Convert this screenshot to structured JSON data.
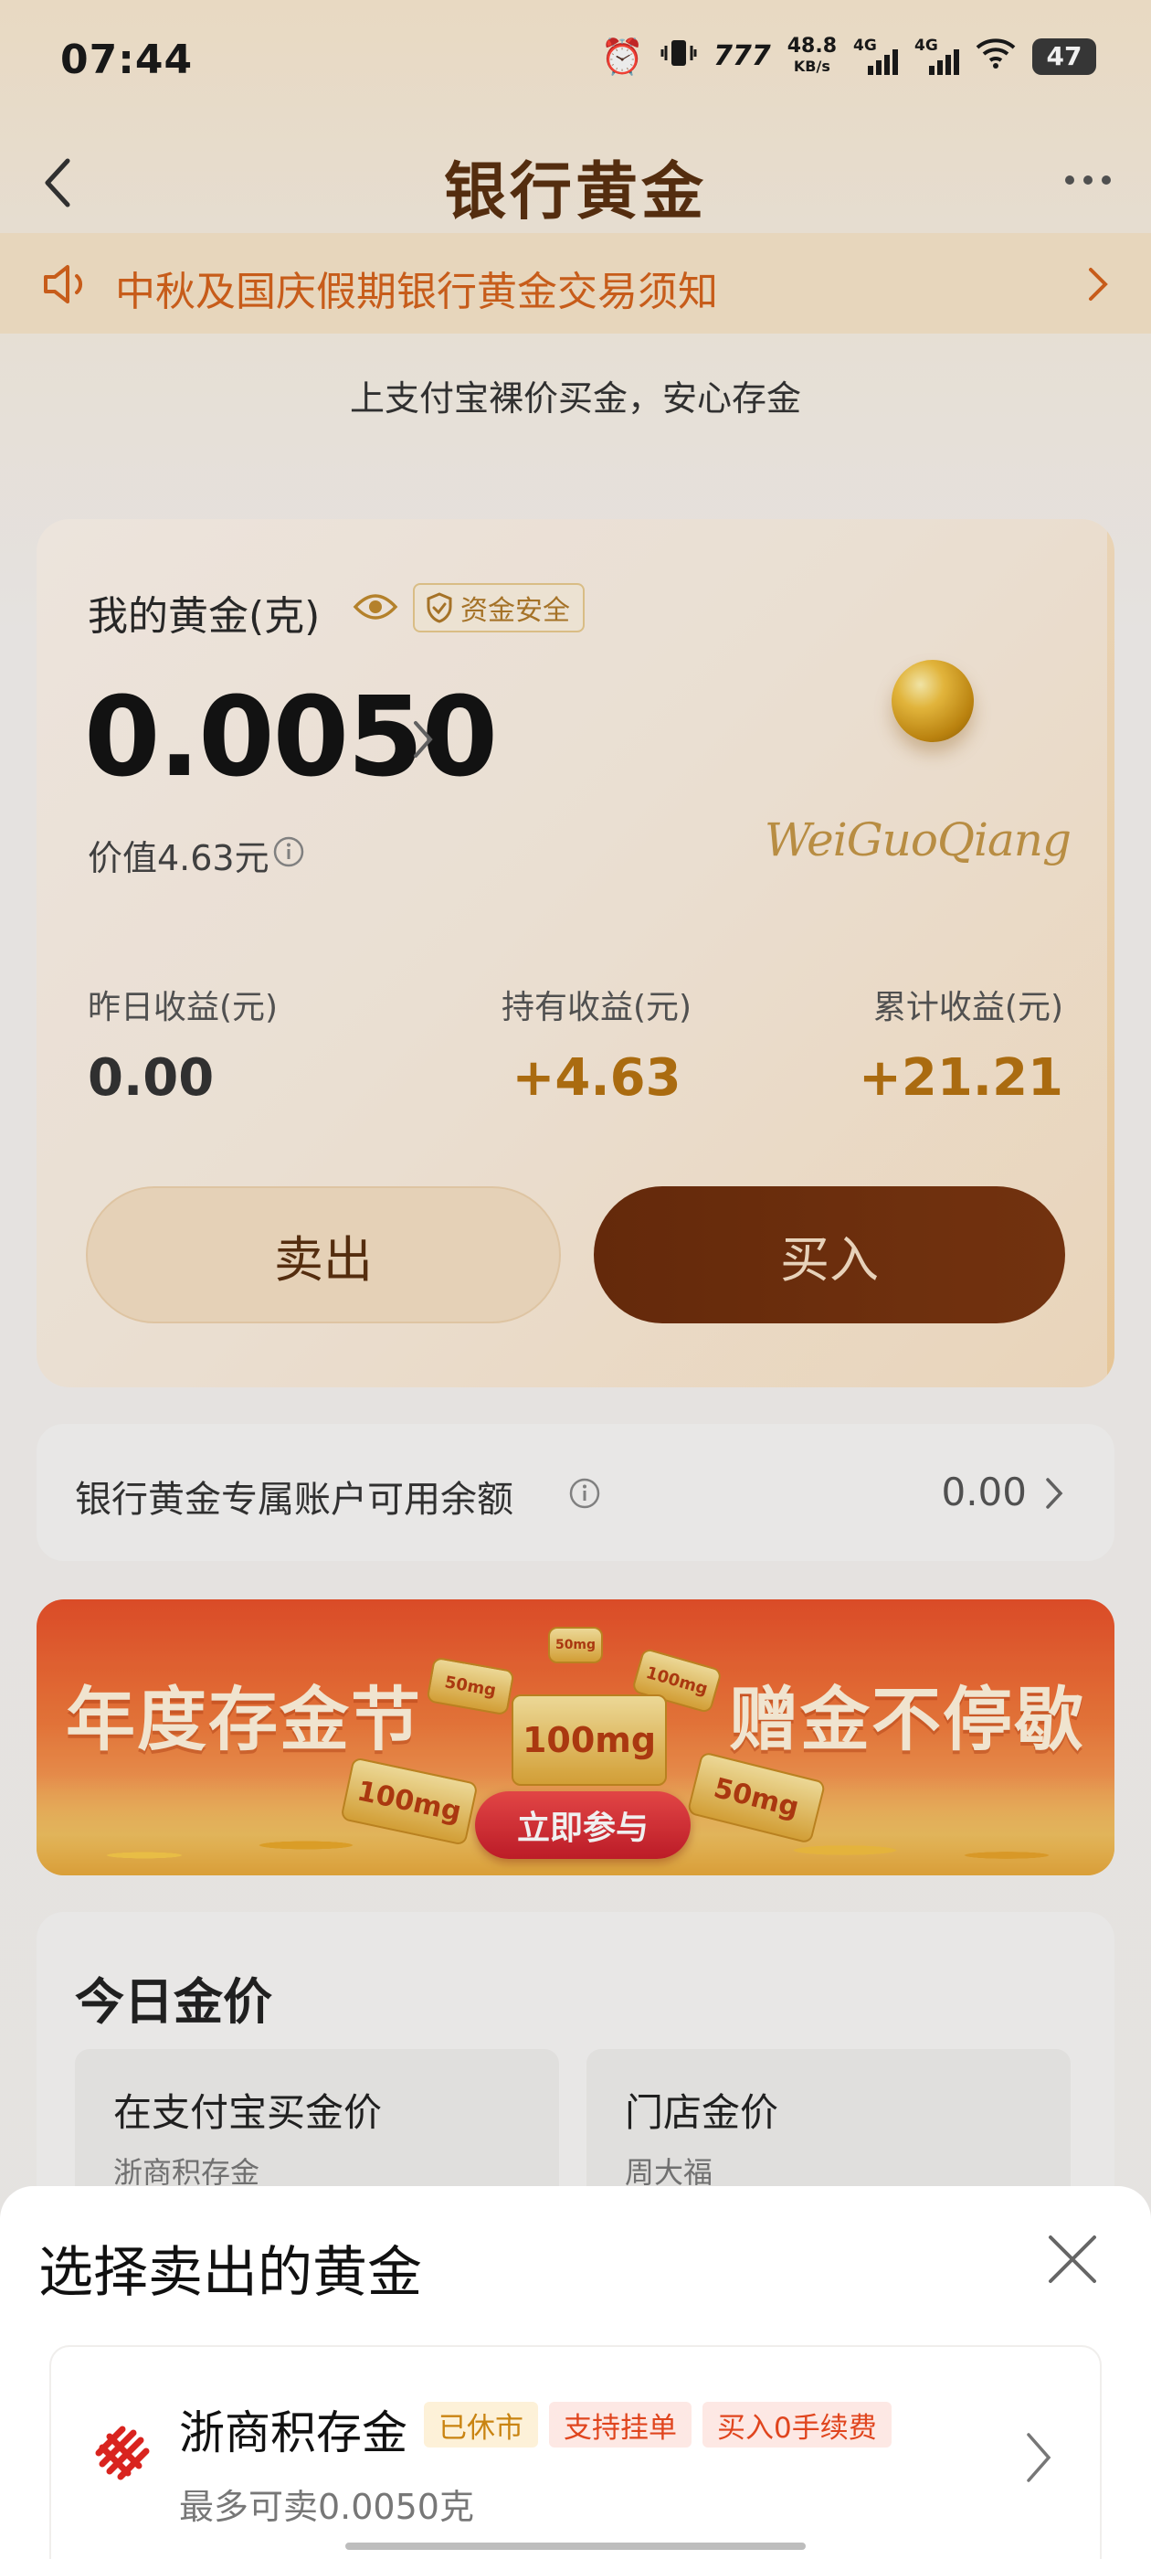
{
  "status_bar": {
    "time": "07:44",
    "net_speed": "48.8",
    "net_unit": "KB/s",
    "signal_1": "4G",
    "signal_2": "4G",
    "battery": "47",
    "icons": [
      "alarm-icon",
      "vibrate-icon",
      "nfc-icon",
      "wifi-icon"
    ]
  },
  "nav": {
    "title": "银行黄金"
  },
  "notice": {
    "text": "中秋及国庆假期银行黄金交易须知"
  },
  "slogan": "上支付宝裸价买金，安心存金",
  "gold_card": {
    "label": "我的黄金(克)",
    "safe_badge": "资金安全",
    "amount": "0.0050",
    "value_text": "价值4.63元",
    "brand_script": "WeiGuoQiang",
    "stats": [
      {
        "label": "昨日收益(元)",
        "value": "0.00"
      },
      {
        "label": "持有收益(元)",
        "value": "+4.63"
      },
      {
        "label": "累计收益(元)",
        "value": "+21.21"
      }
    ],
    "sell_label": "卖出",
    "buy_label": "买入"
  },
  "balance": {
    "label": "银行黄金专属账户可用余额",
    "value": "0.00"
  },
  "banner": {
    "left_text": "年度存金节",
    "right_text": "赠金不停歇",
    "bar_main": "100mg",
    "bar_left": "100mg",
    "bar_right": "50mg",
    "bar_small_1": "50mg",
    "bar_small_2": "100mg",
    "bar_small_3": "50mg",
    "cta": "立即参与"
  },
  "price_section": {
    "title": "今日金价",
    "boxes": [
      {
        "title": "在支付宝买金价",
        "sub": "浙商积存金"
      },
      {
        "title": "门店金价",
        "sub": "周大福"
      }
    ]
  },
  "sheet": {
    "title": "选择卖出的黄金",
    "option": {
      "name": "浙商积存金",
      "tags": [
        "已休市",
        "支持挂单",
        "买入0手续费"
      ],
      "max_sell": "最多可卖0.0050克"
    }
  },
  "colors": {
    "brand_brown": "#6b2c0c",
    "gold_accent": "#b57212",
    "notice_orange": "#d4621c",
    "tag_red": "#e0451e"
  }
}
